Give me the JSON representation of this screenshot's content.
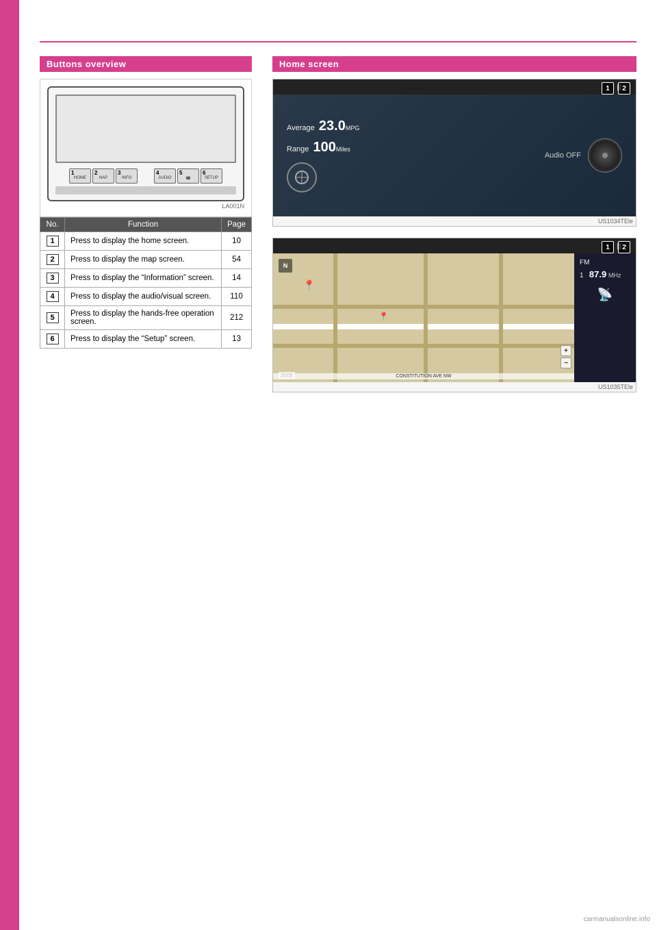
{
  "sidebar": {
    "color": "#d63f8c"
  },
  "buttons_overview": {
    "section_title": "Buttons overview",
    "diagram_caption": "LA001N",
    "table": {
      "col_no": "No.",
      "col_function": "Function",
      "col_page": "Page",
      "rows": [
        {
          "no": "1",
          "function": "Press to display the home screen.",
          "page": "10"
        },
        {
          "no": "2",
          "function": "Press to display the map screen.",
          "page": "54"
        },
        {
          "no": "3",
          "function": "Press to display the “Information” screen.",
          "page": "14"
        },
        {
          "no": "4",
          "function": "Press to display the audio/visual screen.",
          "page": "110"
        },
        {
          "no": "5",
          "function": "Press to display the hands-free operation screen.",
          "page": "212"
        },
        {
          "no": "6",
          "function": "Press to display the “Setup” screen.",
          "page": "13"
        }
      ]
    },
    "device_buttons": [
      "HOME",
      "NAP",
      "INFO",
      "",
      "AUDIO",
      "",
      "SETUP"
    ]
  },
  "home_screen": {
    "section_title": "Home screen",
    "screen1": {
      "caption": "US1034TEle",
      "average_label": "Average",
      "average_value": "23.0",
      "average_unit": "MPG",
      "range_label": "Range",
      "range_value": "100",
      "range_unit": "Miles",
      "audio_label": "Audio OFF",
      "badge1": "1",
      "badge2": "2"
    },
    "screen2": {
      "caption": "US1035TEle",
      "compass": "N",
      "fm_label": "FM",
      "fm_channel": "1",
      "fm_freq": "87.9",
      "fm_unit": "MHz",
      "scale": "300ft",
      "street": "CONSTITUTION AVE NW",
      "badge1": "1",
      "badge2": "2"
    }
  },
  "watermark": "carmanualsonline.info"
}
